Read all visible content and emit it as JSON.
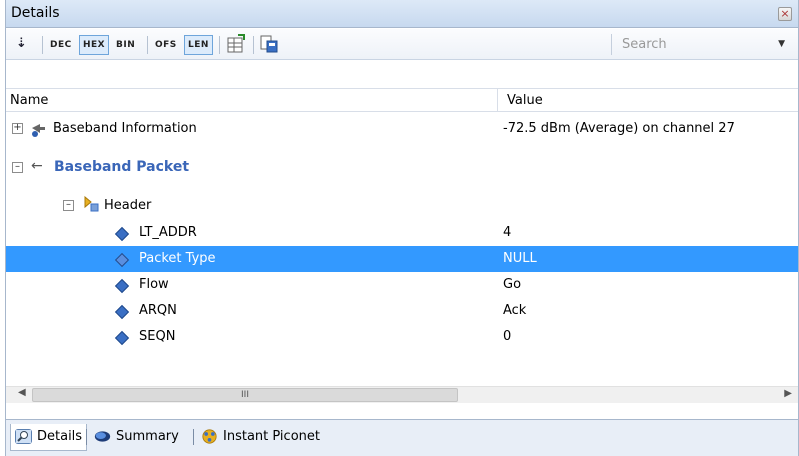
{
  "panel": {
    "title": "Details",
    "close_glyph": "×"
  },
  "toolbar": {
    "expand_icon": "chevrons-down-icon",
    "buttons": [
      {
        "label": "DEC",
        "active": false
      },
      {
        "label": "HEX",
        "active": true
      },
      {
        "label": "BIN",
        "active": false
      },
      {
        "label": "OFS",
        "active": false
      },
      {
        "label": "LEN",
        "active": true
      }
    ],
    "search_placeholder": "Search"
  },
  "columns": {
    "name": "Name",
    "value": "Value"
  },
  "tree": {
    "baseband_info": {
      "label": "Baseband Information",
      "value": "-72.5 dBm (Average) on channel 27"
    },
    "baseband_packet": {
      "label": "Baseband Packet"
    },
    "header": {
      "label": "Header"
    },
    "fields": [
      {
        "label": "LT_ADDR",
        "value": "4"
      },
      {
        "label": "Packet Type",
        "value": "NULL",
        "selected": true
      },
      {
        "label": "Flow",
        "value": "Go"
      },
      {
        "label": "ARQN",
        "value": "Ack"
      },
      {
        "label": "SEQN",
        "value": "0"
      }
    ]
  },
  "scrollbar": {
    "grip": "III"
  },
  "tabs": [
    {
      "label": "Details",
      "icon": "magnifier-icon",
      "active": true
    },
    {
      "label": "Summary",
      "icon": "summary-icon",
      "active": false
    },
    {
      "label": "Instant Piconet",
      "icon": "piconet-icon",
      "active": false
    }
  ],
  "colors": {
    "selection": "#3399ff",
    "packet_title": "#3a66b8"
  }
}
